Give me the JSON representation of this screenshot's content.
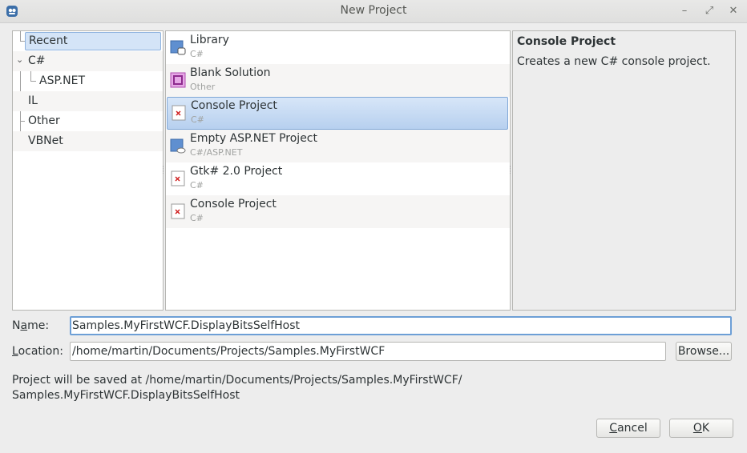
{
  "window": {
    "title": "New Project",
    "controls": {
      "minimize": "–",
      "maximize": "⤢",
      "close": "✕"
    }
  },
  "categories": [
    {
      "label": "Recent",
      "selected": true
    },
    {
      "label": "C#",
      "expanded": true
    },
    {
      "label": "ASP.NET"
    },
    {
      "label": "IL"
    },
    {
      "label": "Other"
    },
    {
      "label": "VBNet"
    }
  ],
  "templates": [
    {
      "name": "Library",
      "language": "C#",
      "icon": "library-icon"
    },
    {
      "name": "Blank Solution",
      "language": "Other",
      "icon": "solution-icon"
    },
    {
      "name": "Console Project",
      "language": "C#",
      "icon": "console-project-icon",
      "selected": true
    },
    {
      "name": "Empty ASP.NET Project",
      "language": "C#/ASP.NET",
      "icon": "web-project-icon"
    },
    {
      "name": "Gtk# 2.0 Project",
      "language": "C#",
      "icon": "gtk-project-icon"
    },
    {
      "name": "Console Project",
      "language": "C#",
      "icon": "console-project-icon"
    }
  ],
  "description": {
    "title": "Console Project",
    "text": "Creates a new C# console project."
  },
  "form": {
    "name_label_prefix": "N",
    "name_label_mnemonic": "a",
    "name_label_suffix": "me:",
    "name_value": "Samples.MyFirstWCF.DisplayBitsSelfHost",
    "location_label_mnemonic": "L",
    "location_label_suffix": "ocation:",
    "location_value": "/home/martin/Documents/Projects/Samples.MyFirstWCF",
    "browse_label": "Browse..."
  },
  "save_info": {
    "line1": "Project will be saved at /home/martin/Documents/Projects/Samples.MyFirstWCF/",
    "line2": "Samples.MyFirstWCF.DisplayBitsSelfHost"
  },
  "buttons": {
    "cancel_mnemonic": "C",
    "cancel_rest": "ancel",
    "ok_mnemonic": "O",
    "ok_rest": "K"
  },
  "colors": {
    "selection_fill": "#b7d0ef",
    "selection_border": "#7fa6d6",
    "focus_border": "#6d9fd6"
  }
}
